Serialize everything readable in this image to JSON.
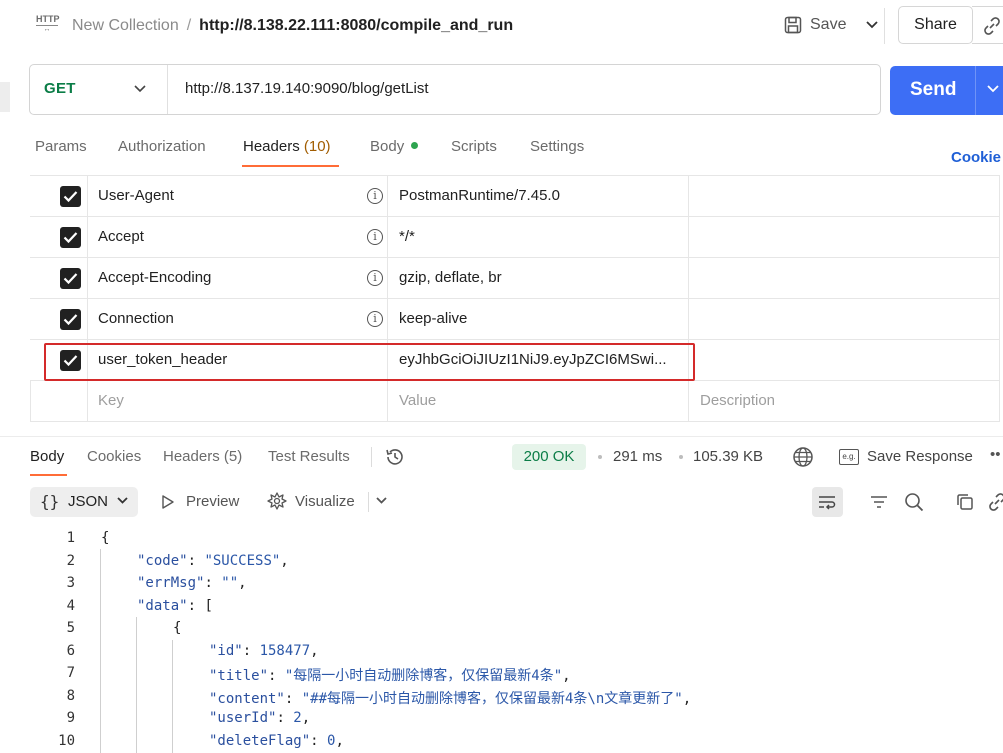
{
  "header": {
    "collection": "New Collection",
    "separator": "/",
    "request_name": "http://8.138.22.111:8080/compile_and_run",
    "http_icon_text": "HTTP",
    "save_label": "Save",
    "share_label": "Share"
  },
  "request": {
    "method": "GET",
    "url": "http://8.137.19.140:9090/blog/getList",
    "send_label": "Send"
  },
  "request_tabs": {
    "params": "Params",
    "authorization": "Authorization",
    "headers": "Headers",
    "headers_count": "(10)",
    "body": "Body",
    "scripts": "Scripts",
    "settings": "Settings",
    "cookies": "Cookie"
  },
  "headers_table": {
    "rows": [
      {
        "key": "User-Agent",
        "value": "PostmanRuntime/7.45.0",
        "checked": true,
        "info": true
      },
      {
        "key": "Accept",
        "value": "*/*",
        "checked": true,
        "info": true
      },
      {
        "key": "Accept-Encoding",
        "value": "gzip, deflate, br",
        "checked": true,
        "info": true
      },
      {
        "key": "Connection",
        "value": "keep-alive",
        "checked": true,
        "info": true
      },
      {
        "key": "user_token_header",
        "value": "eyJhbGciOiJIUzI1NiJ9.eyJpZCI6MSwi...",
        "checked": true,
        "info": false
      }
    ],
    "placeholder_key": "Key",
    "placeholder_value": "Value",
    "placeholder_description": "Description",
    "info_glyph": "i"
  },
  "response_tabs": {
    "body": "Body",
    "cookies": "Cookies",
    "headers": "Headers (5)",
    "test_results": "Test Results"
  },
  "response_meta": {
    "status": "200 OK",
    "time": "291 ms",
    "size": "105.39 KB",
    "save_response": "Save Response",
    "save_icon_text": "e.g.",
    "more": "••"
  },
  "response_toolbar": {
    "format_braces": "{}",
    "format": "JSON",
    "preview": "Preview",
    "visualize": "Visualize"
  },
  "code_lines": {
    "l1": {
      "no": "1",
      "text": "{"
    },
    "l2": {
      "no": "2",
      "key": "\"code\"",
      "colon": ": ",
      "val": "\"SUCCESS\"",
      "tail": ","
    },
    "l3": {
      "no": "3",
      "key": "\"errMsg\"",
      "colon": ": ",
      "val": "\"\"",
      "tail": ","
    },
    "l4": {
      "no": "4",
      "key": "\"data\"",
      "colon": ": ",
      "tail": "["
    },
    "l5": {
      "no": "5",
      "text": "{"
    },
    "l6": {
      "no": "6",
      "key": "\"id\"",
      "colon": ": ",
      "val": "158477",
      "tail": ","
    },
    "l7": {
      "no": "7",
      "key": "\"title\"",
      "colon": ": ",
      "val": "\"每隔一小时自动删除博客，仅保留最新4条\"",
      "tail": ","
    },
    "l8": {
      "no": "8",
      "key": "\"content\"",
      "colon": ": ",
      "val": "\"##每隔一小时自动删除博客，仅保留最新4条\\n文章更新了\"",
      "tail": ","
    },
    "l9": {
      "no": "9",
      "key": "\"userId\"",
      "colon": ": ",
      "val": "2",
      "tail": ","
    },
    "l10": {
      "no": "10",
      "key": "\"deleteFlag\"",
      "colon": ": ",
      "val": "0",
      "tail": ","
    }
  }
}
